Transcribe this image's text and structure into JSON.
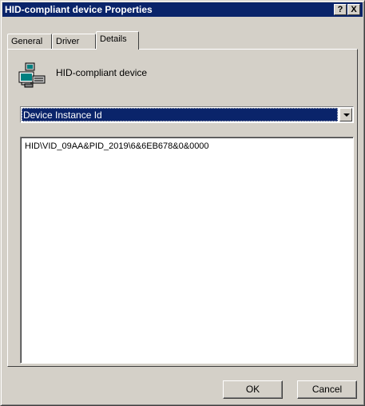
{
  "window": {
    "title": "HID-compliant device Properties",
    "help_button": "?",
    "close_button": "X"
  },
  "tabs": [
    {
      "label": "General",
      "active": false
    },
    {
      "label": "Driver",
      "active": false
    },
    {
      "label": "Details",
      "active": true
    }
  ],
  "details": {
    "device_icon": "hid-device-icon",
    "device_name": "HID-compliant device",
    "property_select": {
      "selected": "Device Instance Id"
    },
    "values": [
      "HID\\VID_09AA&PID_2019\\6&6EB678&0&0000"
    ]
  },
  "buttons": {
    "ok": "OK",
    "cancel": "Cancel"
  },
  "colors": {
    "titlebar": "#0a246a",
    "face": "#d4d0c8",
    "selection": "#0a246a"
  }
}
